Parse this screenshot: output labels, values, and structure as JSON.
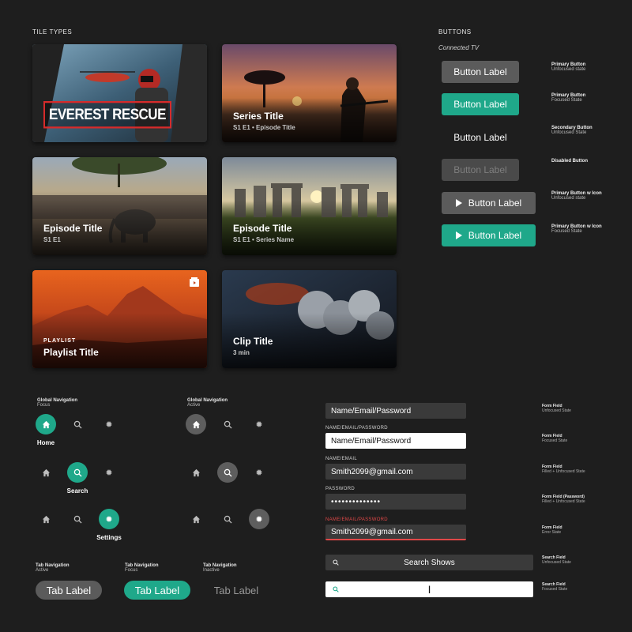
{
  "sections": {
    "tile_types": "TILE TYPES",
    "buttons": "BUTTONS",
    "connected_tv": "Connected TV"
  },
  "tiles": [
    {
      "logo_text": "EVEREST RESCUE"
    },
    {
      "title": "Series Title",
      "subtitle": "S1 E1 • Episode Title"
    },
    {
      "title": "Episode Title",
      "subtitle": "S1 E1"
    },
    {
      "title": "Episode Title",
      "subtitle": "S1 E1 • Series Name"
    },
    {
      "eyebrow": "PLAYLIST",
      "title": "Playlist Title",
      "badge_icon": "playlist-icon"
    },
    {
      "title": "Clip Title",
      "subtitle": "3 min"
    }
  ],
  "buttons": [
    {
      "label": "Button Label",
      "note_title": "Primary Button",
      "note_state": "Unfocused state"
    },
    {
      "label": "Button Label",
      "note_title": "Primary Button",
      "note_state": "Focused State"
    },
    {
      "label": "Button Label",
      "note_title": "Secondary Button",
      "note_state": "Unfocused State"
    },
    {
      "label": "Button Label",
      "note_title": "Disabled Button",
      "note_state": ""
    },
    {
      "label": "Button Label",
      "note_title": "Primary Button w Icon",
      "note_state": "Unfocused state"
    },
    {
      "label": "Button Label",
      "note_title": "Primary Button w Icon",
      "note_state": "Focused State"
    }
  ],
  "global_nav": {
    "focus": {
      "title": "Global Navigation",
      "state": "Focus",
      "labels": {
        "home": "Home",
        "search": "Search",
        "settings": "Settings"
      }
    },
    "active": {
      "title": "Global Navigation",
      "state": "Active"
    }
  },
  "tab_nav": [
    {
      "title": "Tab Navigation",
      "state": "Active",
      "label": "Tab Label"
    },
    {
      "title": "Tab Navigation",
      "state": "Focus",
      "label": "Tab Label"
    },
    {
      "title": "Tab Navigation",
      "state": "Inactive",
      "label": "Tab Label"
    }
  ],
  "form": {
    "field1": {
      "value": "Name/Email/Password",
      "note_title": "Form Field",
      "note_state": "Unfocused State"
    },
    "field2": {
      "label": "NAME/EMAIL/PASSWORD",
      "value": "Name/Email/Password",
      "note_title": "Form Field",
      "note_state": "Focused State"
    },
    "field3": {
      "label": "NAME/EMAIL",
      "value": "Smith2099@gmail.com",
      "note_title": "Form Field",
      "note_state": "Filled + Unfocused State"
    },
    "field4": {
      "label": "PASSWORD",
      "value": "••••••••••••••",
      "note_title": "Form Field (Password)",
      "note_state": "Filled + Unfocused State"
    },
    "field5": {
      "label": "NAME/EMAIL/PASSWORD",
      "value": "Smith2099@gmail.com",
      "note_title": "Form Field",
      "note_state": "Error State"
    },
    "search1": {
      "value": "Search Shows",
      "note_title": "Search Field",
      "note_state": "Unfocused State"
    },
    "search2": {
      "value": "|",
      "note_title": "Search Field",
      "note_state": "Focused State"
    }
  },
  "colors": {
    "accent": "#1fa88a",
    "error": "#e04848",
    "background": "#1e1e1e"
  }
}
